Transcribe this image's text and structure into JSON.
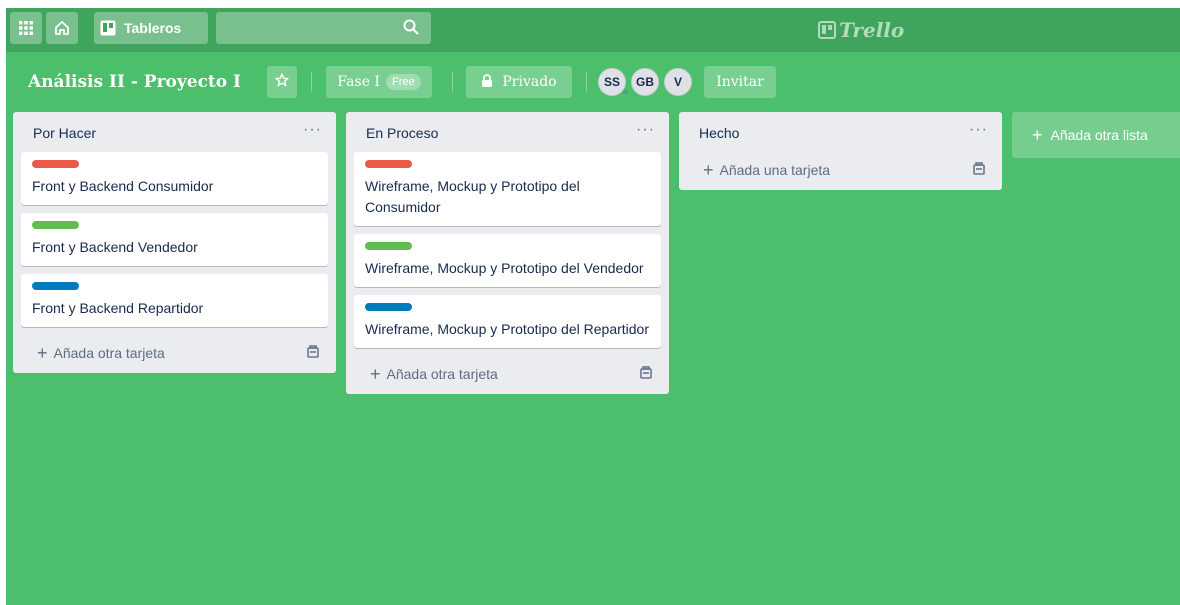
{
  "header": {
    "boards_label": "Tableros",
    "search": {
      "value": "",
      "placeholder": ""
    },
    "logo_text": "Trello"
  },
  "board": {
    "title": "Análisis II - Proyecto I",
    "team": "Fase I",
    "team_badge": "Free",
    "visibility": "Privado",
    "members": [
      "SS",
      "GB",
      "V"
    ],
    "invite_label": "Invitar"
  },
  "lists": [
    {
      "title": "Por Hacer",
      "menu": "···",
      "cards": [
        {
          "label_color": "#eb5a46",
          "text": "Front y Backend Consumidor"
        },
        {
          "label_color": "#61bd4f",
          "text": "Front y Backend Vendedor"
        },
        {
          "label_color": "#0079bf",
          "text": "Front y Backend Repartidor"
        }
      ],
      "add_label": "Añada otra tarjeta"
    },
    {
      "title": "En Proceso",
      "menu": "···",
      "cards": [
        {
          "label_color": "#eb5a46",
          "text": "Wireframe, Mockup y Prototipo del Consumidor"
        },
        {
          "label_color": "#61bd4f",
          "text": "Wireframe, Mockup y Prototipo del Vendedor"
        },
        {
          "label_color": "#0079bf",
          "text": "Wireframe, Mockup y Prototipo del Repartidor"
        }
      ],
      "add_label": "Añada otra tarjeta"
    },
    {
      "title": "Hecho",
      "menu": "···",
      "cards": [],
      "add_label": "Añada una tarjeta"
    }
  ],
  "add_list_label": "Añada otra lista",
  "colors": {
    "board_bg": "#4bbf6b",
    "header_bg": "#3fa55d",
    "list_bg": "#ebecf0"
  },
  "icons": [
    "apps-grid-icon",
    "home-icon",
    "boards-icon",
    "search-icon",
    "star-icon",
    "lock-icon",
    "plus-icon",
    "card-template-icon",
    "admin-chevron-icon"
  ]
}
